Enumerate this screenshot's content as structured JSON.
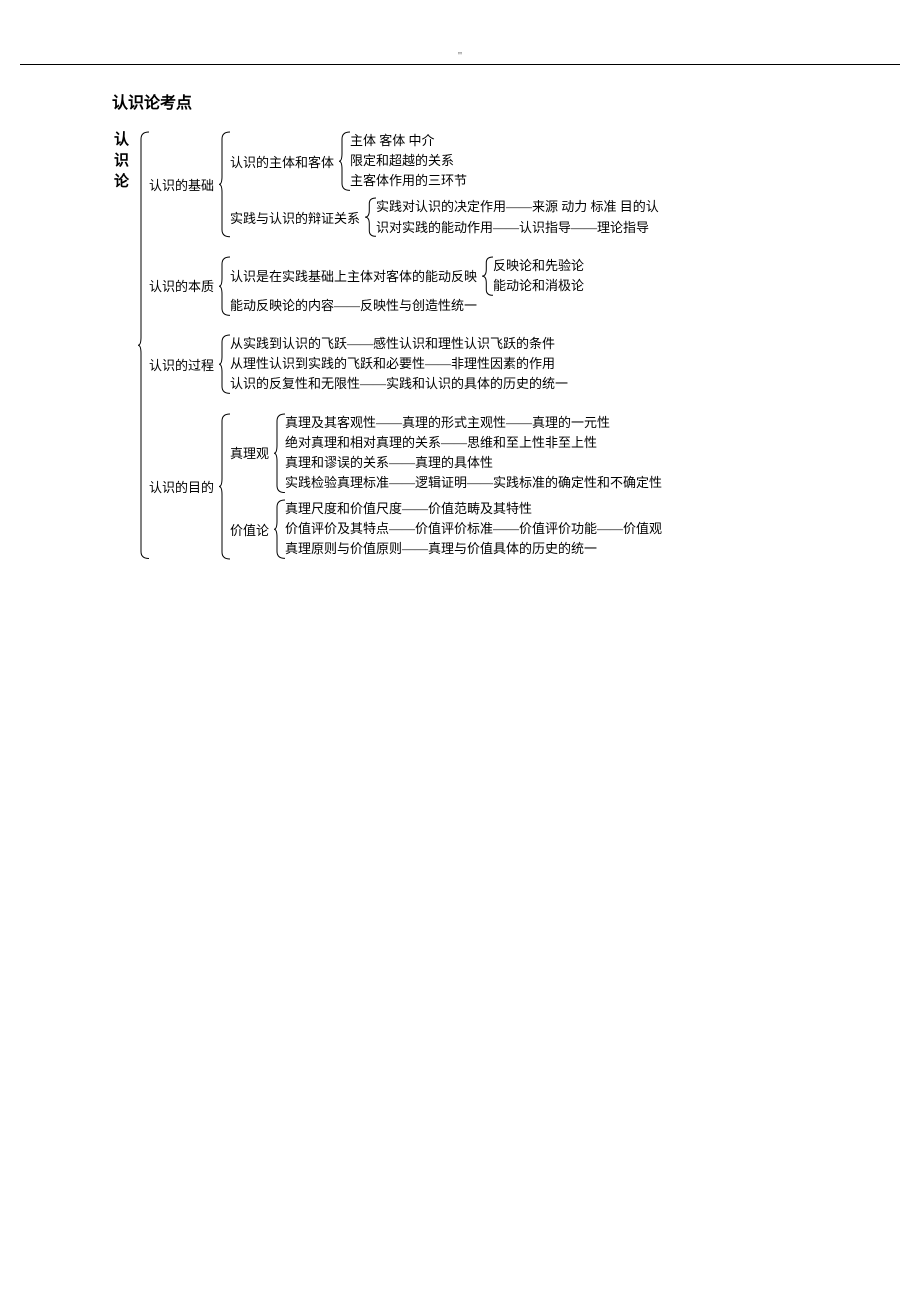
{
  "header_mark": "\"",
  "title": "认识论考点",
  "root_label": "认识论",
  "sections": [
    {
      "label": "认识的基础",
      "children": [
        {
          "label": "认识的主体和客体",
          "children": [
            {
              "leaf": "主体  客体  中介"
            },
            {
              "leaf": "限定和超越的关系"
            },
            {
              "leaf": "主客体作用的三环节"
            }
          ]
        },
        {
          "label": "实践与认识的辩证关系",
          "children": [
            {
              "leaf": "实践对认识的决定作用——来源  动力  标准  目的认"
            },
            {
              "leaf": "识对实践的能动作用——认识指导——理论指导"
            }
          ]
        }
      ]
    },
    {
      "label": "认识的本质",
      "children": [
        {
          "label": "认识是在实践基础上主体对客体的能动反映",
          "children": [
            {
              "leaf": "反映论和先验论"
            },
            {
              "leaf": "能动论和消极论"
            }
          ]
        },
        {
          "leaf": "能动反映论的内容——反映性与创造性统一"
        }
      ]
    },
    {
      "label": "认识的过程",
      "children": [
        {
          "leaf": "从实践到认识的飞跃——感性认识和理性认识飞跃的条件"
        },
        {
          "leaf": "从理性认识到实践的飞跃和必要性——非理性因素的作用"
        },
        {
          "leaf": "认识的反复性和无限性——实践和认识的具体的历史的统一"
        }
      ]
    },
    {
      "label": "认识的目的",
      "children": [
        {
          "label": "真理观",
          "children": [
            {
              "leaf": "真理及其客观性——真理的形式主观性——真理的一元性"
            },
            {
              "leaf": "绝对真理和相对真理的关系——思维和至上性非至上性"
            },
            {
              "leaf": "真理和谬误的关系——真理的具体性"
            },
            {
              "leaf": "实践检验真理标准——逻辑证明——实践标准的确定性和不确定性"
            }
          ]
        },
        {
          "label": "价值论",
          "children": [
            {
              "leaf": "真理尺度和价值尺度——价值范畴及其特性"
            },
            {
              "leaf": "价值评价及其特点——价值评价标准——价值评价功能——价值观"
            },
            {
              "leaf": "真理原则与价值原则——真理与价值具体的历史的统一"
            }
          ]
        }
      ]
    }
  ]
}
